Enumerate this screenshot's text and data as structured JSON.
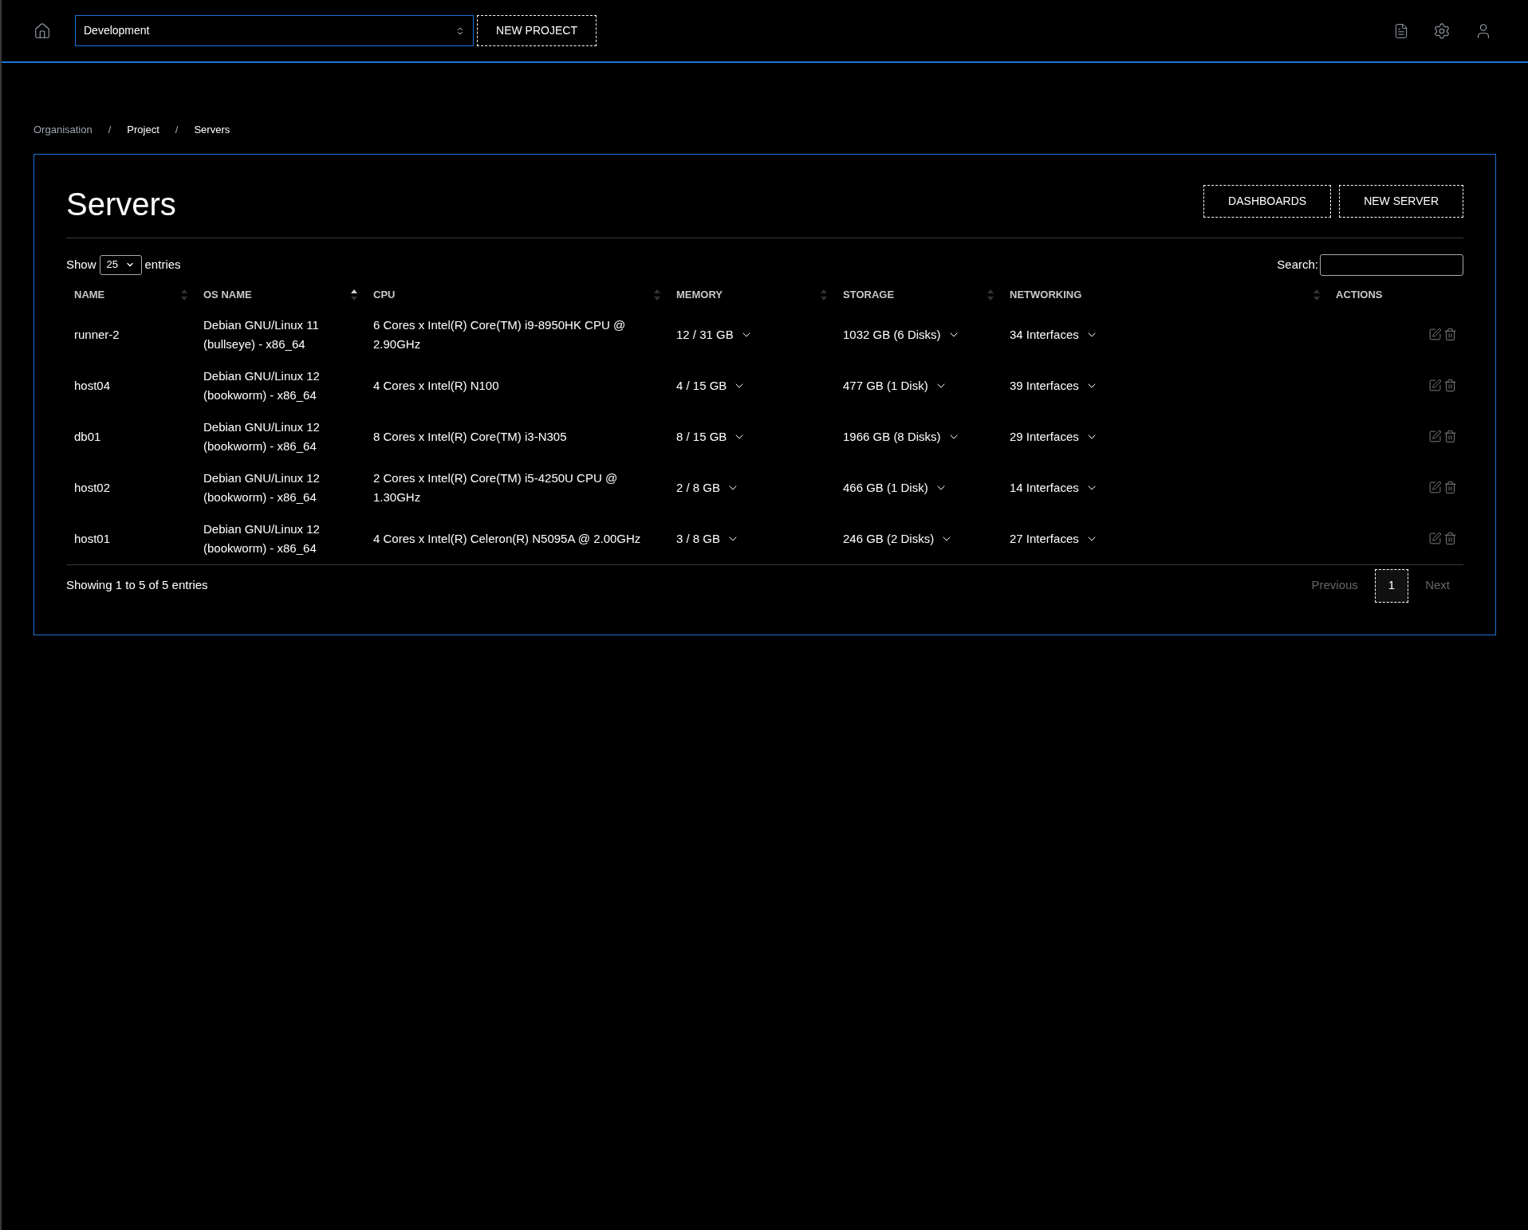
{
  "topbar": {
    "project_select": {
      "value": "Development"
    },
    "new_project_button": "NEW PROJECT"
  },
  "breadcrumb": [
    {
      "label": "Organisation",
      "dimmed": true
    },
    {
      "label": "Project",
      "dimmed": false
    },
    {
      "label": "Servers",
      "dimmed": false
    }
  ],
  "breadcrumb_separator": "/",
  "page": {
    "title": "Servers",
    "buttons": [
      "DASHBOARDS",
      "NEW SERVER"
    ]
  },
  "table_controls": {
    "show_label": "Show",
    "page_size": "25",
    "entries_label": "entries",
    "search_label": "Search:"
  },
  "table": {
    "columns": [
      {
        "label": "NAME",
        "sortable": true,
        "sorted": false
      },
      {
        "label": "OS NAME",
        "sortable": true,
        "sorted": true
      },
      {
        "label": "CPU",
        "sortable": true,
        "sorted": false
      },
      {
        "label": "MEMORY",
        "sortable": true,
        "sorted": false
      },
      {
        "label": "STORAGE",
        "sortable": true,
        "sorted": false
      },
      {
        "label": "NETWORKING",
        "sortable": true,
        "sorted": false
      },
      {
        "label": "ACTIONS",
        "sortable": false
      }
    ],
    "rows": [
      {
        "name": "runner-2",
        "os": "Debian GNU/Linux 11 (bullseye) - x86_64",
        "cpu": "6 Cores x Intel(R) Core(TM) i9-8950HK CPU @ 2.90GHz",
        "memory": "12 / 31 GB",
        "storage": "1032 GB (6 Disks)",
        "networking": "34 Interfaces"
      },
      {
        "name": "host04",
        "os": "Debian GNU/Linux 12 (bookworm) - x86_64",
        "cpu": "4 Cores x Intel(R) N100",
        "memory": "4 / 15 GB",
        "storage": "477 GB (1 Disk)",
        "networking": "39 Interfaces"
      },
      {
        "name": "db01",
        "os": "Debian GNU/Linux 12 (bookworm) - x86_64",
        "cpu": "8 Cores x Intel(R) Core(TM) i3-N305",
        "memory": "8 / 15 GB",
        "storage": "1966 GB (8 Disks)",
        "networking": "29 Interfaces"
      },
      {
        "name": "host02",
        "os": "Debian GNU/Linux 12 (bookworm) - x86_64",
        "cpu": "2 Cores x Intel(R) Core(TM) i5-4250U CPU @ 1.30GHz",
        "memory": "2 / 8 GB",
        "storage": "466 GB (1 Disk)",
        "networking": "14 Interfaces"
      },
      {
        "name": "host01",
        "os": "Debian GNU/Linux 12 (bookworm) - x86_64",
        "cpu": "4 Cores x Intel(R) Celeron(R) N5095A @ 2.00GHz",
        "memory": "3 / 8 GB",
        "storage": "246 GB (2 Disks)",
        "networking": "27 Interfaces"
      }
    ]
  },
  "footer": {
    "info": "Showing 1 to 5 of 5 entries",
    "pagination": [
      {
        "label": "Previous",
        "disabled": true,
        "selected": false
      },
      {
        "label": "1",
        "disabled": false,
        "selected": true
      },
      {
        "label": "Next",
        "disabled": true,
        "selected": false
      }
    ]
  }
}
